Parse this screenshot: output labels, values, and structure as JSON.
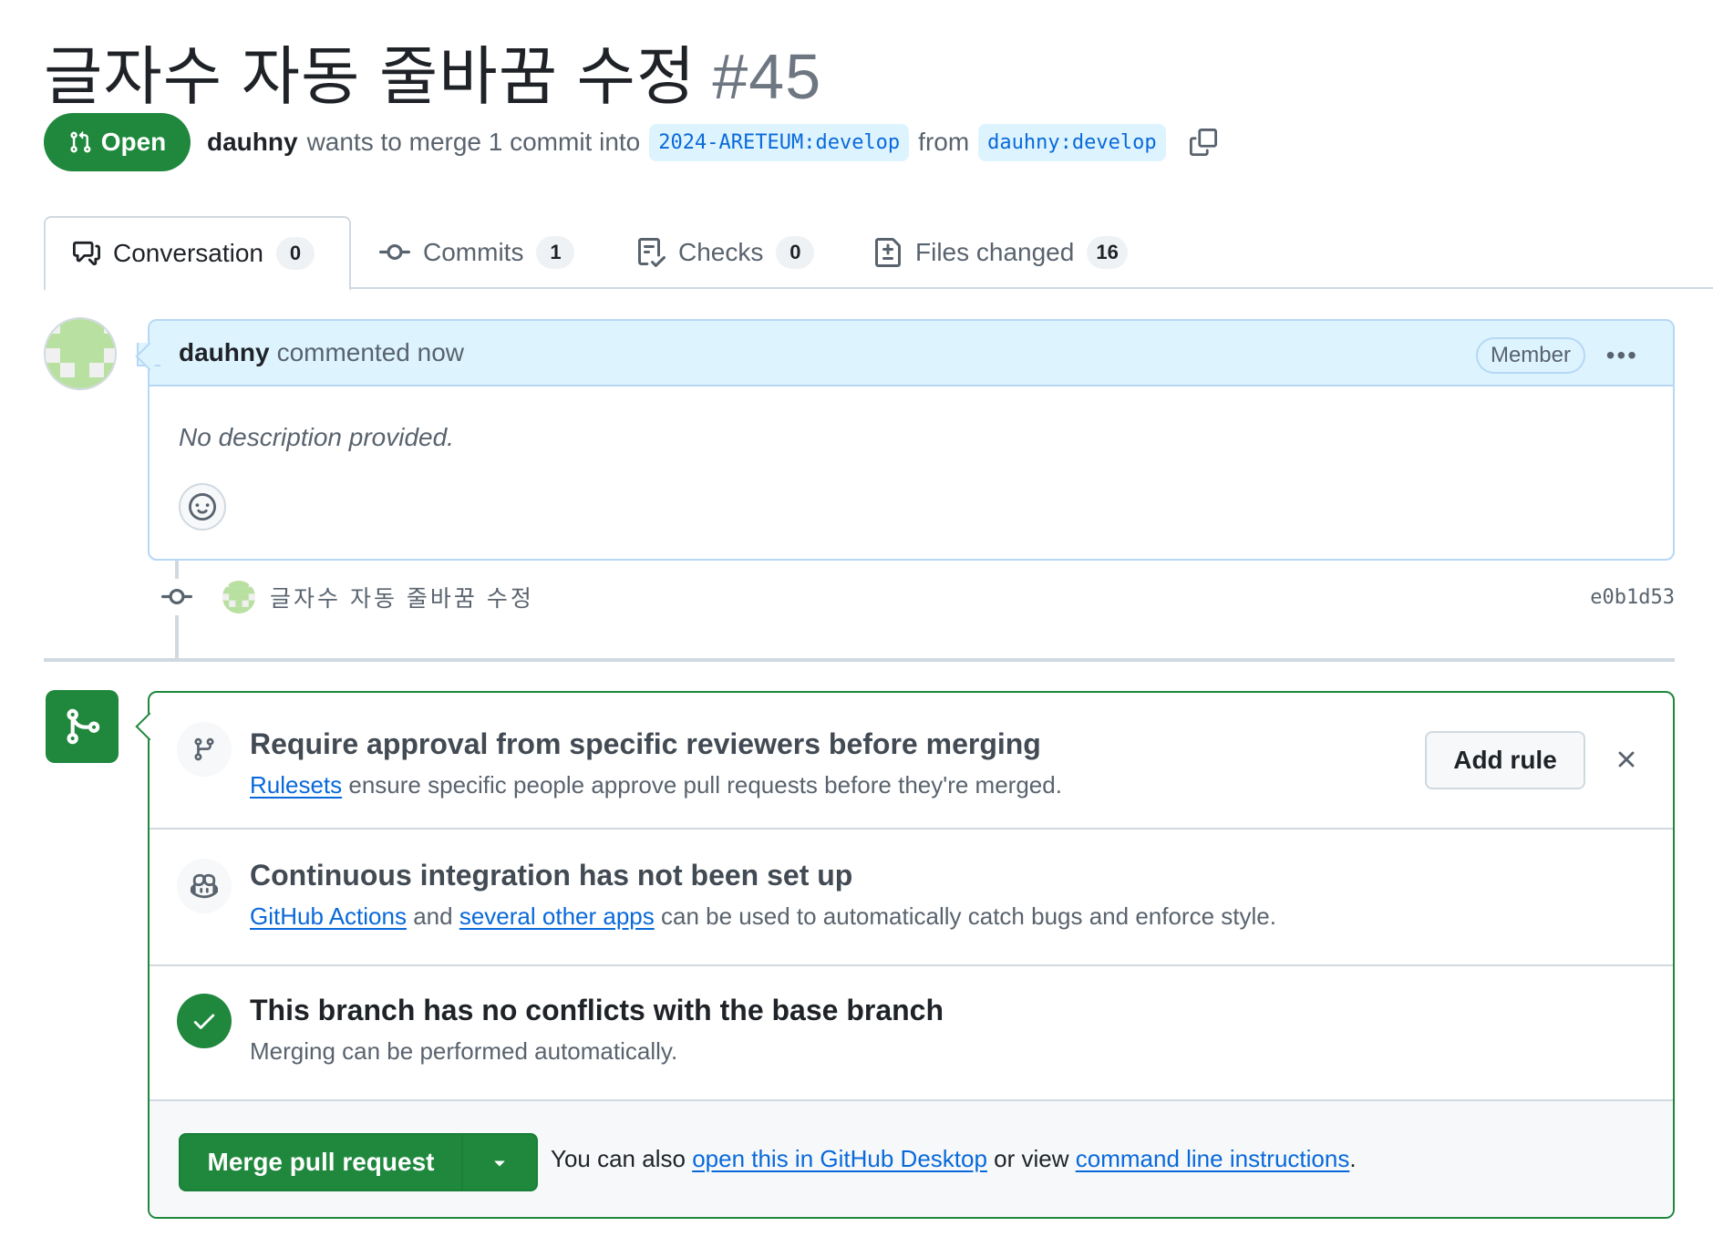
{
  "pr": {
    "title": "글자수 자동 줄바꿈 수정",
    "number": "#45",
    "state": "Open",
    "author": "dauhny",
    "meta_middle": "wants to merge 1 commit into",
    "base_branch": "2024-ARETEUM:develop",
    "meta_from": "from",
    "head_branch": "dauhny:develop"
  },
  "tabs": [
    {
      "label": "Conversation",
      "count": "0",
      "icon": "comment-discussion-icon"
    },
    {
      "label": "Commits",
      "count": "1",
      "icon": "git-commit-icon"
    },
    {
      "label": "Checks",
      "count": "0",
      "icon": "checklist-icon"
    },
    {
      "label": "Files changed",
      "count": "16",
      "icon": "file-diff-icon"
    }
  ],
  "comment": {
    "author": "dauhny",
    "action": "commented now",
    "role": "Member",
    "body": "No description provided."
  },
  "commit": {
    "message": "글자수 자동 줄바꿈 수정",
    "sha": "e0b1d53"
  },
  "merge": {
    "rule": {
      "title": "Require approval from specific reviewers before merging",
      "link": "Rulesets",
      "text": "ensure specific people approve pull requests before they're merged.",
      "button": "Add rule"
    },
    "ci": {
      "title": "Continuous integration has not been set up",
      "link1": "GitHub Actions",
      "and": "and",
      "link2": "several other apps",
      "text": "can be used to automatically catch bugs and enforce style."
    },
    "conflicts": {
      "title": "This branch has no conflicts with the base branch",
      "text": "Merging can be performed automatically."
    },
    "footer": {
      "button": "Merge pull request",
      "prefix": "You can also",
      "link1": "open this in GitHub Desktop",
      "middle": "or view",
      "link2": "command line instructions",
      "suffix": "."
    }
  },
  "colors": {
    "open_green": "#1f883d",
    "link_blue": "#0969da",
    "header_blue": "#ddf4ff"
  }
}
